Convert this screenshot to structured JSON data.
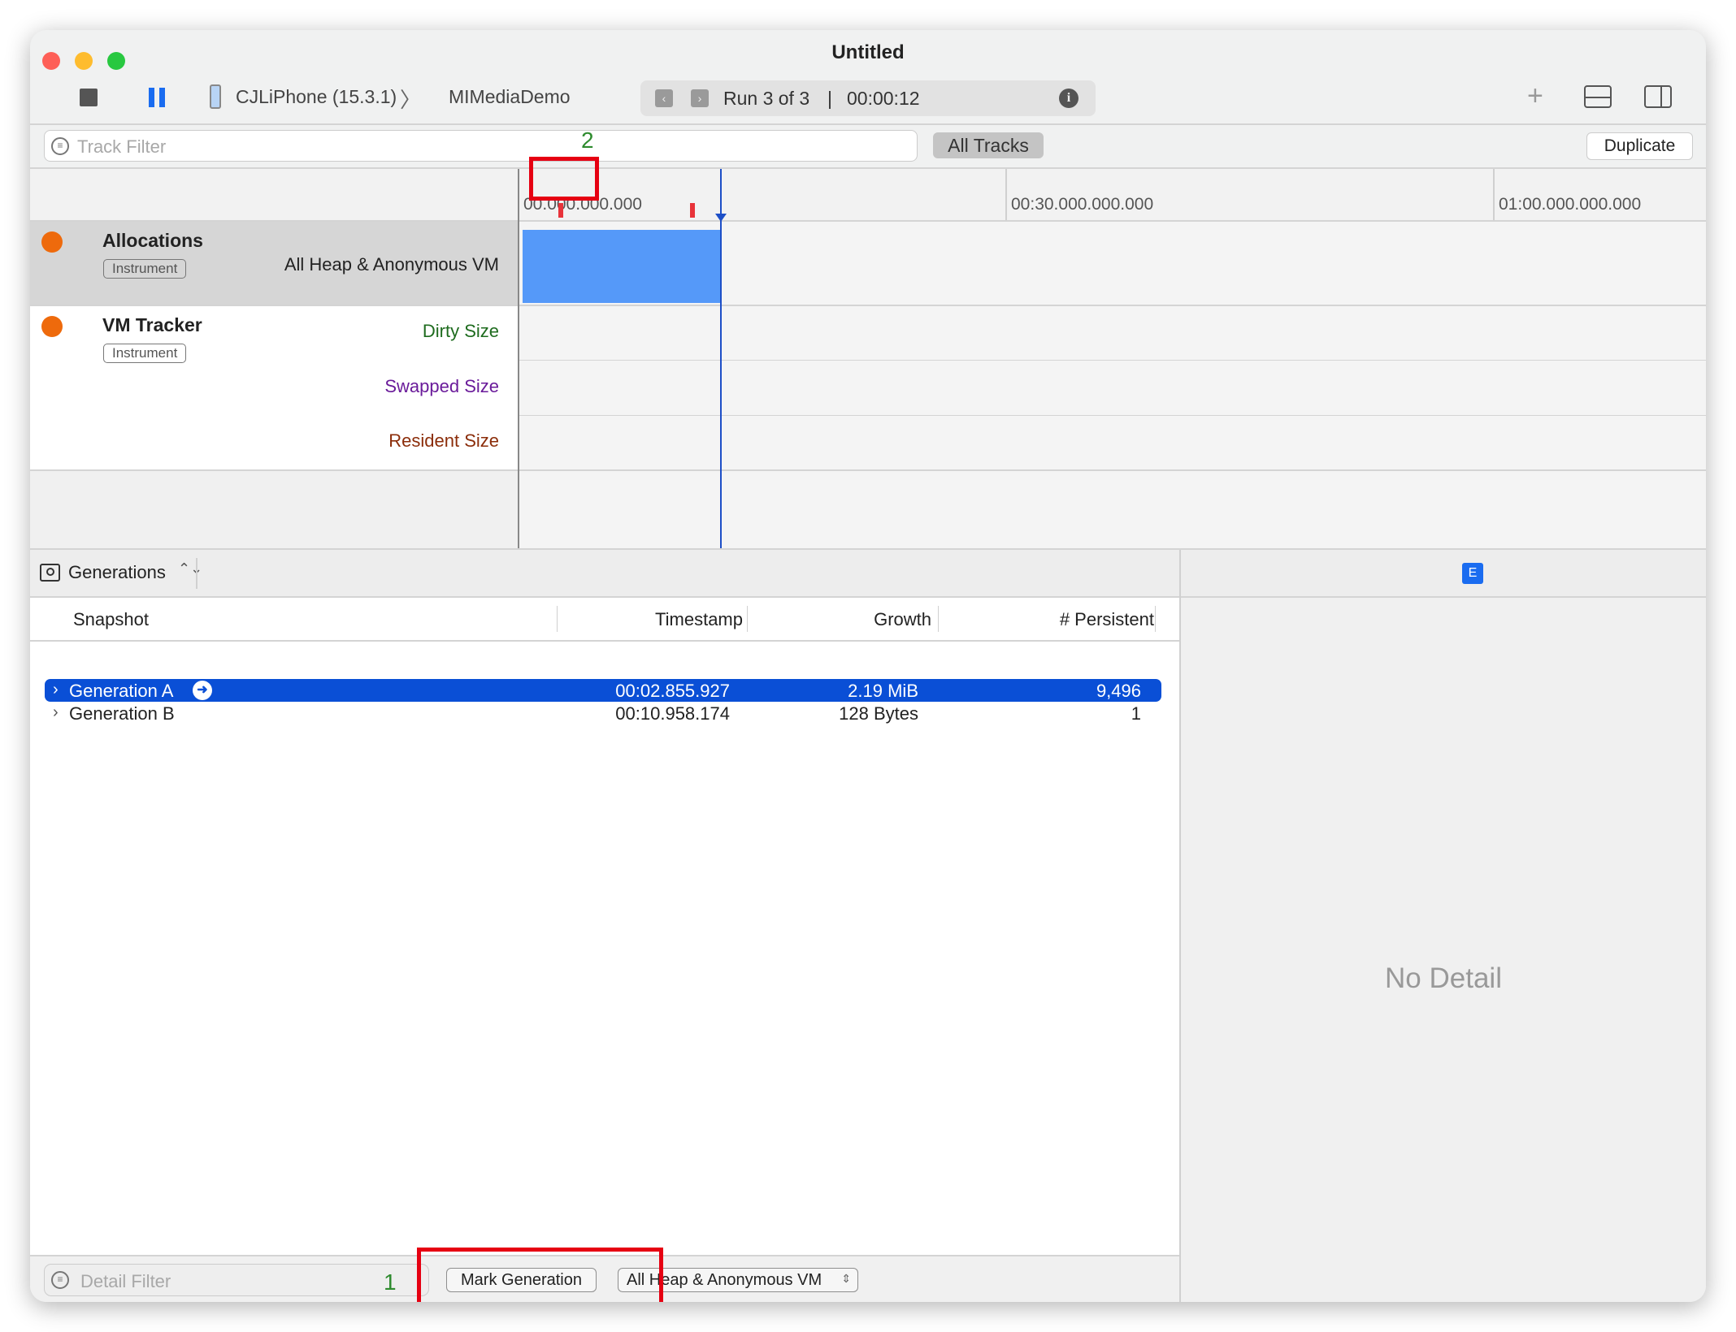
{
  "window": {
    "title": "Untitled"
  },
  "toolbar": {
    "device": "CJLiPhone (15.3.1)",
    "app": "MIMediaDemo",
    "run": "Run 3 of 3",
    "elapsed": "00:00:12",
    "separator": "|"
  },
  "filter_bar": {
    "track_filter_placeholder": "Track Filter",
    "annotation_2": "2",
    "all_tracks": "All Tracks",
    "duplicate": "Duplicate"
  },
  "ruler": {
    "labels": [
      "00:00.000.000.000",
      "00:30.000.000.000",
      "01:00.000.000.000"
    ],
    "shown_first": "00.000.000.000"
  },
  "tracks": [
    {
      "name": "Allocations",
      "badge": "Instrument",
      "series": [
        "All Heap & Anonymous VM"
      ],
      "series_colors": [
        "#222222"
      ],
      "icon_color": "#ee6a0c",
      "fill_color": "#5599f9"
    },
    {
      "name": "VM Tracker",
      "badge": "Instrument",
      "series": [
        "Dirty Size",
        "Swapped Size",
        "Resident Size"
      ],
      "series_colors": [
        "#1e6b1e",
        "#6a1b9a",
        "#8b2d0a"
      ],
      "icon_color": "#ee6a0c"
    }
  ],
  "detail": {
    "view_selector": "Generations",
    "columns": [
      "Snapshot",
      "Timestamp",
      "Growth",
      "# Persistent"
    ],
    "rows": [
      {
        "snapshot": "Generation A",
        "timestamp": "00:02.855.927",
        "growth": "2.19 MiB",
        "persistent": "9,496",
        "selected": true
      },
      {
        "snapshot": "Generation B",
        "timestamp": "00:10.958.174",
        "growth": "128 Bytes",
        "persistent": "1",
        "selected": false
      }
    ],
    "extended_badge": "E",
    "no_detail": "No Detail"
  },
  "footer": {
    "detail_filter_placeholder": "Detail Filter",
    "annotation_1": "1",
    "mark_generation": "Mark Generation",
    "allocation_type": "All Heap & Anonymous VM"
  },
  "colors": {
    "selection": "#0a4fd6",
    "playhead": "#1d4fc7",
    "flag": "#e8333a",
    "annotation_box": "#e60012",
    "annotation_text": "#2e8b2e"
  }
}
